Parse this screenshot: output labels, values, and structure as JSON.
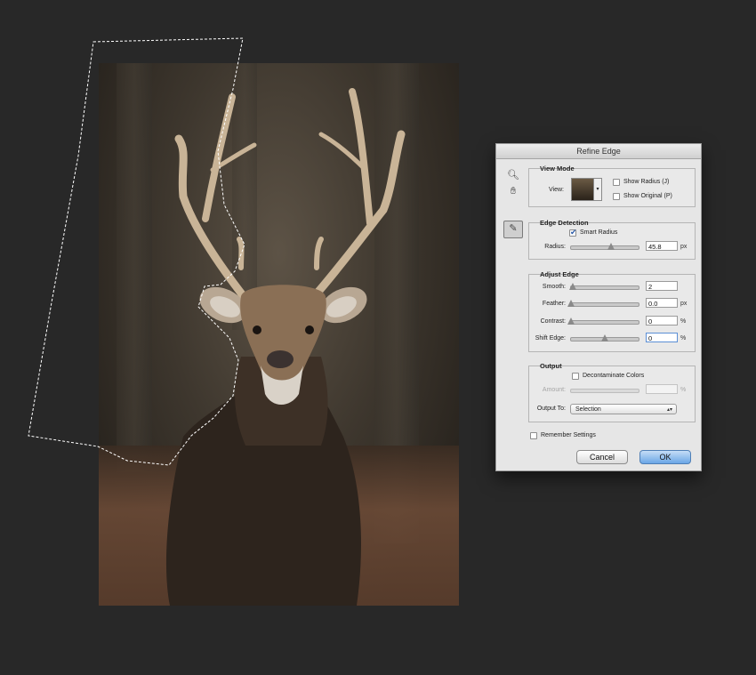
{
  "dialog": {
    "title": "Refine Edge",
    "tools": {
      "zoom_icon": "magnifier-icon",
      "hand_icon": "hand-icon",
      "brush_icon": "refine-radius-brush-icon"
    },
    "view_mode": {
      "section_title": "View Mode",
      "view_label": "View:",
      "show_radius_label": "Show Radius (J)",
      "show_radius_checked": false,
      "show_original_label": "Show Original (P)",
      "show_original_checked": false
    },
    "edge_detection": {
      "section_title": "Edge Detection",
      "smart_radius_label": "Smart Radius",
      "smart_radius_checked": true,
      "radius_label": "Radius:",
      "radius_value": "45.8",
      "radius_unit": "px",
      "radius_slider_fraction": 0.6
    },
    "adjust_edge": {
      "section_title": "Adjust Edge",
      "smooth_label": "Smooth:",
      "smooth_value": "2",
      "smooth_slider_fraction": 0.02,
      "feather_label": "Feather:",
      "feather_value": "0.0",
      "feather_unit": "px",
      "feather_slider_fraction": 0.0,
      "contrast_label": "Contrast:",
      "contrast_value": "0",
      "contrast_unit": "%",
      "contrast_slider_fraction": 0.0,
      "shift_edge_label": "Shift Edge:",
      "shift_edge_value": "0",
      "shift_edge_unit": "%",
      "shift_edge_slider_fraction": 0.5
    },
    "output": {
      "section_title": "Output",
      "decontaminate_label": "Decontaminate Colors",
      "decontaminate_checked": false,
      "amount_label": "Amount:",
      "amount_unit": "%",
      "output_to_label": "Output To:",
      "output_to_value": "Selection"
    },
    "remember_settings_label": "Remember Settings",
    "remember_settings_checked": false,
    "cancel_label": "Cancel",
    "ok_label": "OK"
  }
}
